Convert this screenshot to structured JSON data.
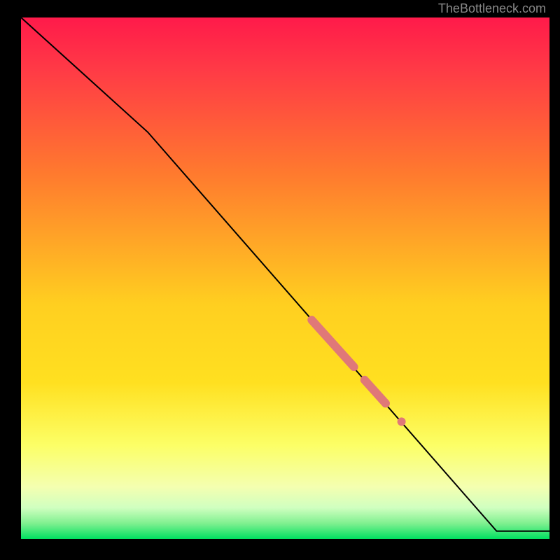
{
  "attribution": "TheBottleneck.com",
  "colors": {
    "gradient_top": "#ff1a4a",
    "gradient_mid1": "#ff7a2e",
    "gradient_mid2": "#ffe020",
    "gradient_mid3": "#fcff66",
    "gradient_bottom": "#00e060",
    "line": "#000000",
    "marker": "#e07878",
    "background": "#000000"
  },
  "chart_data": {
    "type": "line",
    "title": "",
    "xlabel": "",
    "ylabel": "",
    "xlim": [
      0,
      100
    ],
    "ylim": [
      0,
      100
    ],
    "x": [
      0,
      24,
      90,
      100
    ],
    "values": [
      100,
      78,
      1.5,
      1.5
    ],
    "markers": [
      {
        "kind": "segment",
        "x0": 55,
        "y0": 42,
        "x1": 63,
        "y1": 33,
        "width": 12
      },
      {
        "kind": "segment",
        "x0": 65,
        "y0": 30.5,
        "x1": 69,
        "y1": 26,
        "width": 12
      },
      {
        "kind": "point",
        "x": 72,
        "y": 22.5,
        "r": 6
      }
    ],
    "note": "Axes unlabeled; values estimated from pixel positions on a 0-100 normalized scale. Line descends from top-left, bends near x≈24, continues nearly linearly to x≈90 where it flattens near y≈1.5."
  }
}
